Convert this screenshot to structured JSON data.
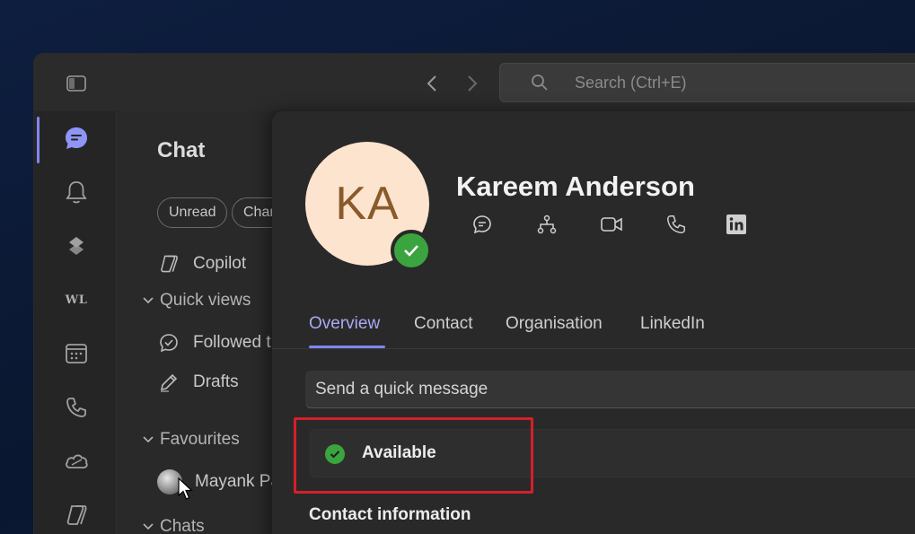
{
  "titlebar": {
    "search_placeholder": "Search (Ctrl+E)"
  },
  "rail": {
    "items": [
      "chat-icon",
      "bell-icon",
      "planner-icon",
      "WL",
      "calendar-icon",
      "phone-icon",
      "onedrive-icon",
      "copilot-icon"
    ]
  },
  "chat_panel": {
    "title": "Chat",
    "filters": [
      "Unread",
      "Chan"
    ],
    "copilot_label": "Copilot",
    "quick_views_label": "Quick views",
    "followed_label": "Followed t",
    "drafts_label": "Drafts",
    "favourites_label": "Favourites",
    "favourite_contact": "Mayank Pa",
    "chats_label": "Chats"
  },
  "profile": {
    "initials": "KA",
    "name": "Kareem Anderson",
    "tabs": [
      "Overview",
      "Contact",
      "Organisation",
      "LinkedIn"
    ],
    "active_tab": "Overview",
    "quick_message_placeholder": "Send a quick message",
    "status": "Available",
    "contact_section_title": "Contact information",
    "colors": {
      "accent": "#7f85f5",
      "presence_available": "#3aa43e",
      "highlight_box": "#d4202a"
    }
  }
}
